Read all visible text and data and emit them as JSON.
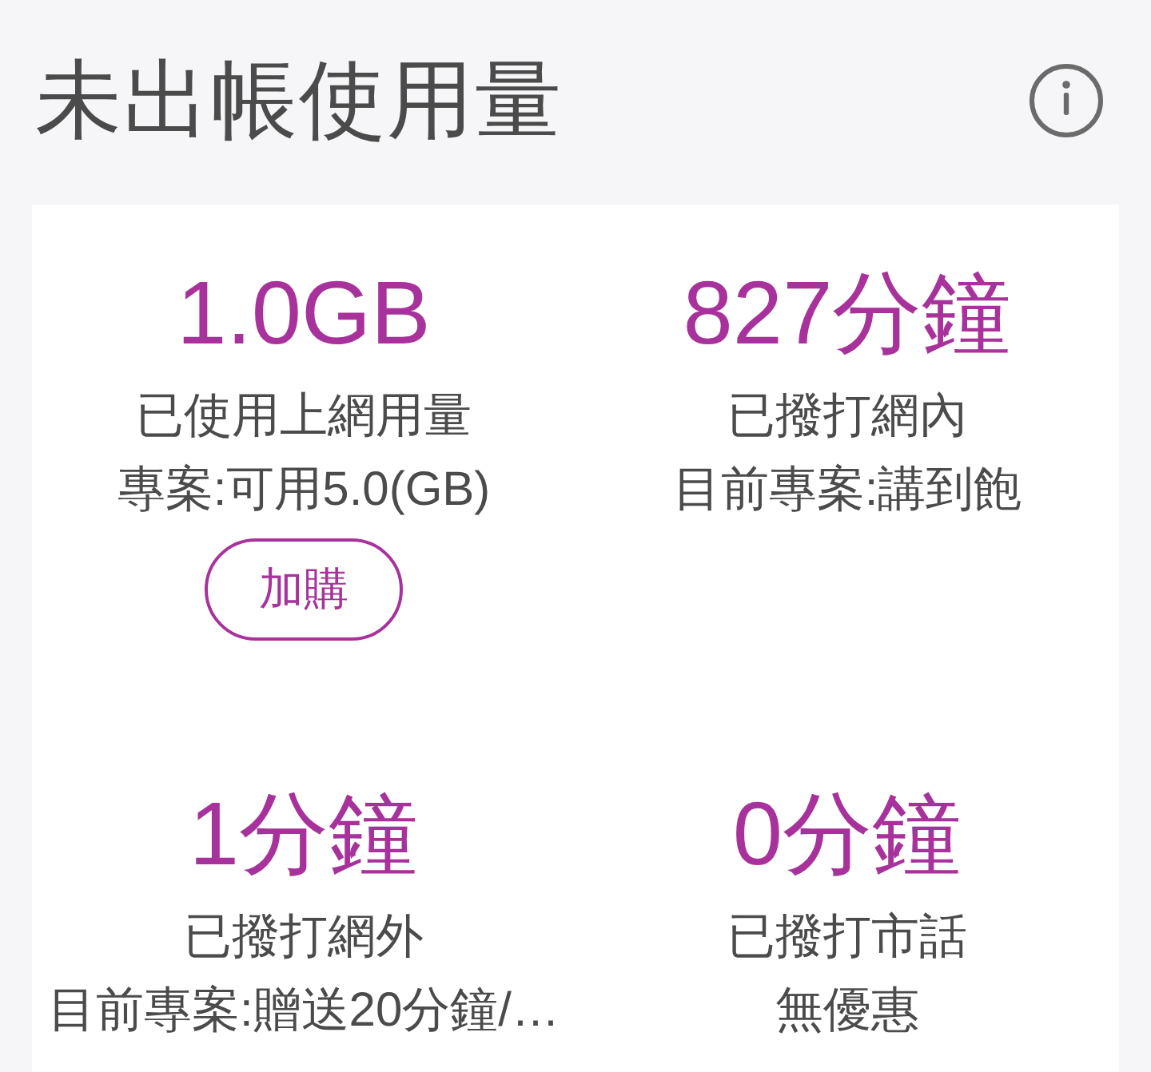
{
  "header": {
    "title": "未出帳使用量"
  },
  "usage_items": [
    {
      "value": "1.0GB",
      "label": "已使用上網用量",
      "plan": "專案:可用5.0(GB)",
      "button": "加購"
    },
    {
      "value": "827分鐘",
      "label": "已撥打網內",
      "plan": "目前專案:講到飽"
    },
    {
      "value": "1分鐘",
      "label": "已撥打網外",
      "plan": "目前專案:贈送20分鐘/…"
    },
    {
      "value": "0分鐘",
      "label": "已撥打市話",
      "plan": "無優惠"
    }
  ]
}
